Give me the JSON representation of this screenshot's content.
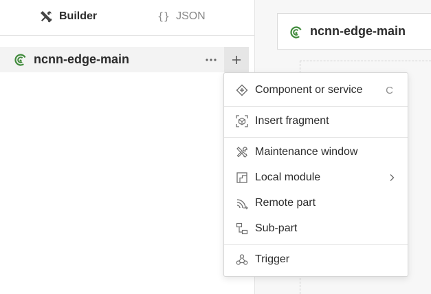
{
  "tabs": {
    "builder": {
      "label": "Builder",
      "icon": "tools-icon"
    },
    "json": {
      "label": "JSON",
      "icon": "braces-icon",
      "glyph": "{}"
    }
  },
  "tree": {
    "root": {
      "label": "ncnn-edge-main",
      "icon": "signal-icon",
      "more": "more-icon",
      "add": "plus-icon"
    }
  },
  "canvas": {
    "node": {
      "label": "ncnn-edge-main",
      "icon": "signal-icon"
    }
  },
  "menu": {
    "items": [
      {
        "label": "Component or service",
        "shortcut": "C",
        "icon": "component-icon"
      },
      {
        "label": "Insert fragment",
        "icon": "fragment-icon"
      },
      {
        "label": "Maintenance window",
        "icon": "tools-icon"
      },
      {
        "label": "Local module",
        "icon": "module-icon",
        "submenu": true
      },
      {
        "label": "Remote part",
        "icon": "remote-icon"
      },
      {
        "label": "Sub-part",
        "icon": "subpart-icon"
      },
      {
        "label": "Trigger",
        "icon": "trigger-icon"
      }
    ]
  },
  "colors": {
    "accent_green": "#3f8a3a",
    "selected_row_bg": "#f3f3f3",
    "icon_gray": "#6e6e6e"
  }
}
